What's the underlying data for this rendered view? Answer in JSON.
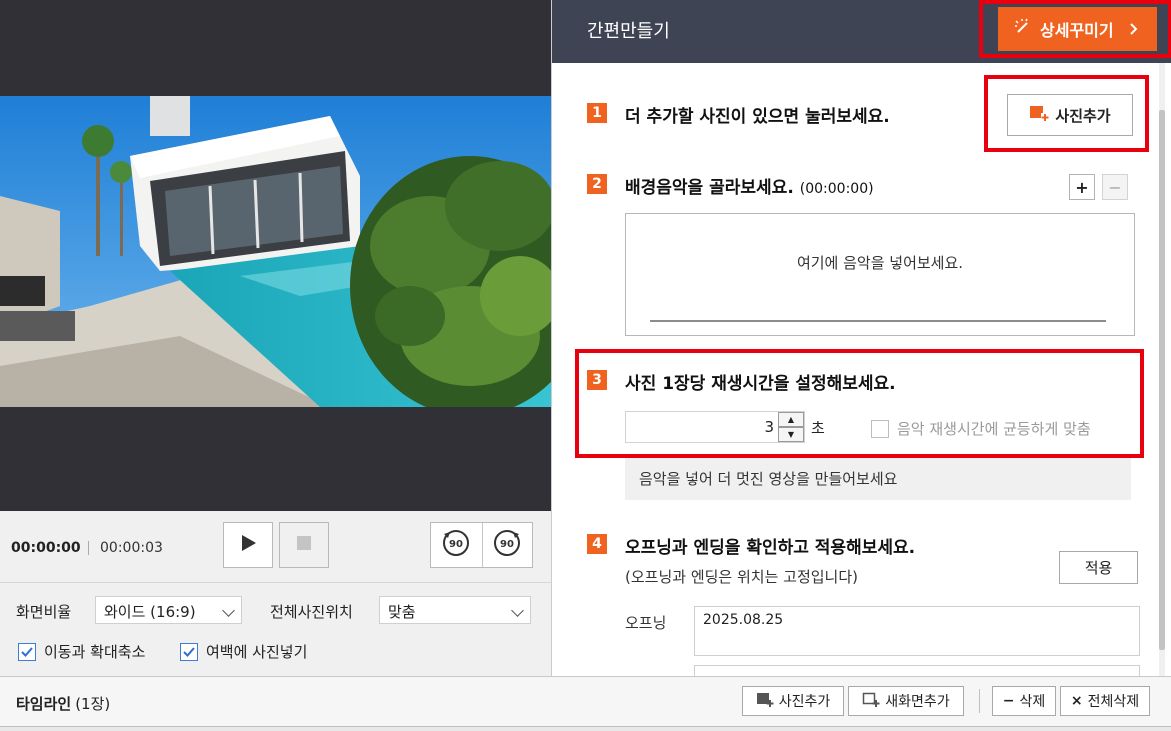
{
  "header": {
    "title": "간편만들기",
    "detail_button": "상세꾸미기"
  },
  "steps": {
    "s1": {
      "num": "1",
      "text": "더 추가할 사진이 있으면 눌러보세요.",
      "add_photo": "사진추가"
    },
    "s2": {
      "num": "2",
      "text": "배경음악을 골라보세요.",
      "duration": "(00:00:00)",
      "plus": "+",
      "minus": "−",
      "placeholder": "여기에 음악을 넣어보세요."
    },
    "s3": {
      "num": "3",
      "text": "사진 1장당 재생시간을 설정해보세요.",
      "seconds": "3",
      "unit": "초",
      "sync_label": "음악 재생시간에 균등하게 맞춤",
      "tip": "음악을 넣어 더 멋진 영상을 만들어보세요"
    },
    "s4": {
      "num": "4",
      "text": "오프닝과 엔딩을 확인하고 적용해보세요.",
      "note": "(오프닝과 엔딩은 위치는 고정입니다)",
      "apply": "적용",
      "opening_label": "오프닝",
      "opening_value": "2025.08.25"
    }
  },
  "player": {
    "current_time": "00:00:00",
    "total_time": "00:00:03"
  },
  "options": {
    "ratio_label": "화면비율",
    "ratio_value": "와이드 (16:9)",
    "position_label": "전체사진위치",
    "position_value": "맞춤",
    "motion_label": "이동과 확대축소",
    "motion_checked": true,
    "fill_label": "여백에 사진넣기",
    "fill_checked": true
  },
  "timeline": {
    "title": "타임라인",
    "count": "(1장)",
    "add_photo": "사진추가",
    "new_screen": "새화면추가",
    "delete": "삭제",
    "delete_all": "전체삭제"
  },
  "colors": {
    "accent": "#f0621f",
    "header_bg": "#3f4454",
    "highlight": "#e8000f",
    "preview_bg": "#303036"
  }
}
